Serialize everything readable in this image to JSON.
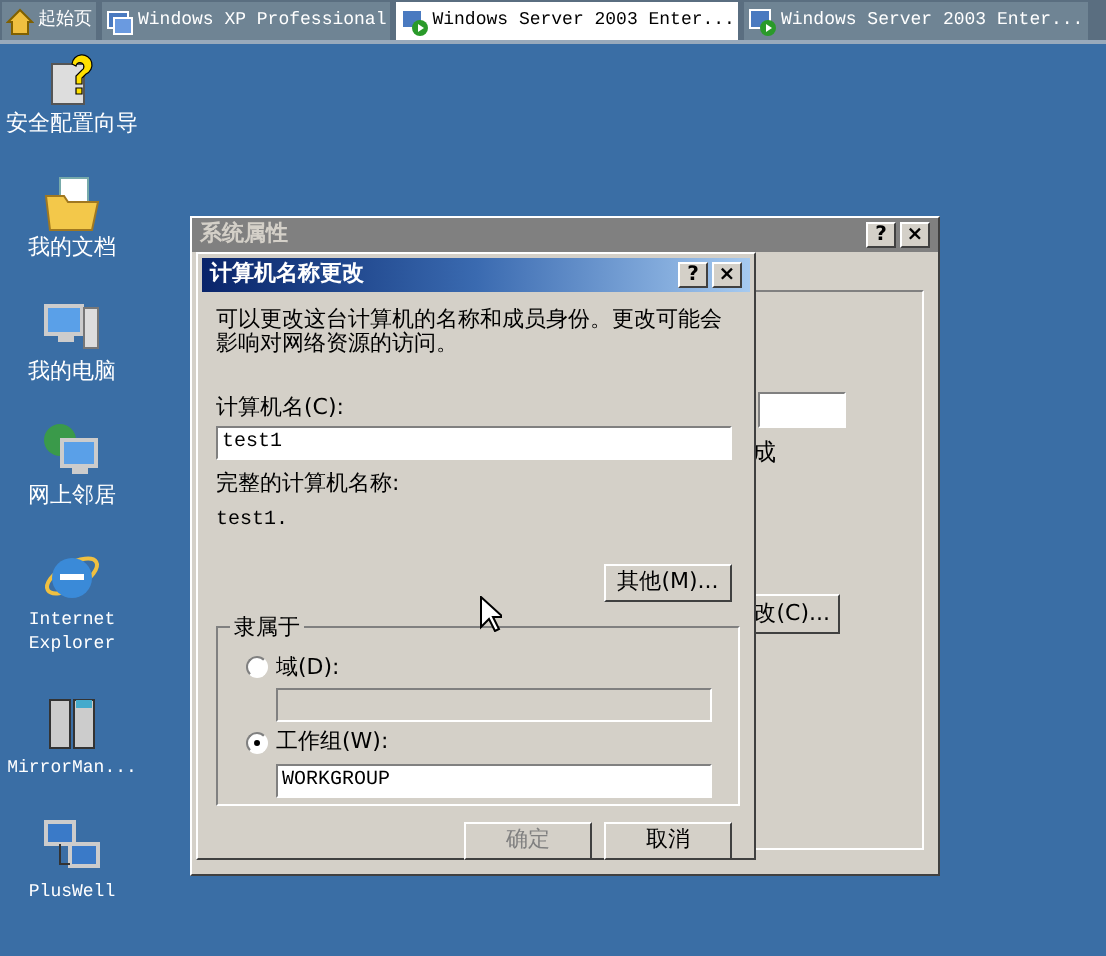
{
  "tabs": [
    {
      "label": "起始页",
      "kind": "home",
      "selected": false
    },
    {
      "label": "Windows XP Professional",
      "kind": "vm",
      "selected": false
    },
    {
      "label": "Windows Server 2003 Enter...",
      "kind": "vm-running",
      "selected": true
    },
    {
      "label": "Windows Server 2003 Enter...",
      "kind": "vm-running",
      "selected": false
    }
  ],
  "desktop_icons": [
    {
      "label": "安全配置向导",
      "kind": "wizard"
    },
    {
      "label": "我的文档",
      "kind": "documents"
    },
    {
      "label": "我的电脑",
      "kind": "computer"
    },
    {
      "label": "网上邻居",
      "kind": "network"
    },
    {
      "label": "Internet Explorer",
      "kind": "browser"
    },
    {
      "label": "MirrorMan...",
      "kind": "servers"
    },
    {
      "label": "PlusWell",
      "kind": "pcs"
    }
  ],
  "back_window": {
    "title": "系统属性",
    "title_buttons": [
      "?",
      "×"
    ],
    "text_fragment": "成",
    "button": "改(C)..."
  },
  "dialog": {
    "title": "计算机名称更改",
    "title_buttons": [
      "?",
      "×"
    ],
    "description": "可以更改这台计算机的名称和成员身份。更改可能会影响对网络资源的访问。",
    "name_label": "计算机名(C):",
    "name_value": "test1",
    "full_name_label": "完整的计算机名称:",
    "full_name": "test1.",
    "more_button": "其他(M)...",
    "member_of": {
      "legend": "隶属于",
      "options": [
        {
          "label": "域(D):",
          "selected": false
        },
        {
          "label": "工作组(W):",
          "selected": true,
          "value": "WORKGROUP"
        }
      ]
    },
    "buttons": [
      {
        "label": "确定",
        "disabled": true
      },
      {
        "label": "取消",
        "disabled": false
      }
    ]
  }
}
